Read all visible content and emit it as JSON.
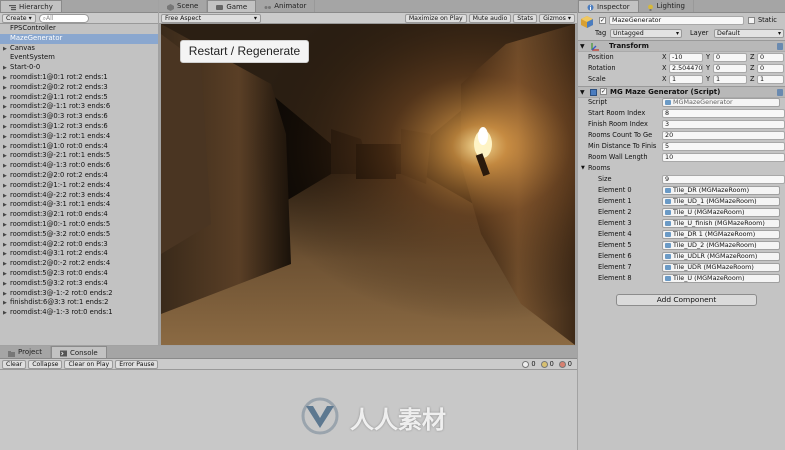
{
  "hierarchy": {
    "tab": "Hierarchy",
    "create": "Create",
    "search_placeholder": "All",
    "items": [
      {
        "label": "FPSController",
        "arrow": ""
      },
      {
        "label": "MazeGenerator",
        "arrow": "",
        "selected": true
      },
      {
        "label": "Canvas",
        "arrow": "▶"
      },
      {
        "label": "EventSystem",
        "arrow": ""
      },
      {
        "label": "Start-0-0",
        "arrow": "▶"
      },
      {
        "label": "roomdist:1@0:1 rot:2 ends:1",
        "arrow": "▶"
      },
      {
        "label": "roomdist:2@0:2 rot:2 ends:3",
        "arrow": "▶"
      },
      {
        "label": "roomdist:2@1:1 rot:2 ends:5",
        "arrow": "▶"
      },
      {
        "label": "roomdist:2@-1:1 rot:3 ends:6",
        "arrow": "▶"
      },
      {
        "label": "roomdist:3@0:3 rot:3 ends:6",
        "arrow": "▶"
      },
      {
        "label": "roomdist:3@1:2 rot:3 ends:6",
        "arrow": "▶"
      },
      {
        "label": "roomdist:3@-1:2 rot:1 ends:4",
        "arrow": "▶"
      },
      {
        "label": "roomdist:1@1:0 rot:0 ends:4",
        "arrow": "▶"
      },
      {
        "label": "roomdist:3@-2:1 rot:1 ends:5",
        "arrow": "▶"
      },
      {
        "label": "roomdist:4@-1:3 rot:0 ends:6",
        "arrow": "▶"
      },
      {
        "label": "roomdist:2@2:0 rot:2 ends:4",
        "arrow": "▶"
      },
      {
        "label": "roomdist:2@1:-1 rot:2 ends:4",
        "arrow": "▶"
      },
      {
        "label": "roomdist:4@-2:2 rot:3 ends:4",
        "arrow": "▶"
      },
      {
        "label": "roomdist:4@-3:1 rot:1 ends:4",
        "arrow": "▶"
      },
      {
        "label": "roomdist:3@2:1 rot:0 ends:4",
        "arrow": "▶"
      },
      {
        "label": "roomdist:1@0:-1 rot:0 ends:5",
        "arrow": "▶"
      },
      {
        "label": "roomdist:5@-3:2 rot:0 ends:5",
        "arrow": "▶"
      },
      {
        "label": "roomdist:4@2:2 rot:0 ends:3",
        "arrow": "▶"
      },
      {
        "label": "roomdist:4@3:1 rot:2 ends:4",
        "arrow": "▶"
      },
      {
        "label": "roomdist:2@0:-2 rot:2 ends:4",
        "arrow": "▶"
      },
      {
        "label": "roomdist:5@2:3 rot:0 ends:4",
        "arrow": "▶"
      },
      {
        "label": "roomdist:5@3:2 rot:3 ends:4",
        "arrow": "▶"
      },
      {
        "label": "roomdist:3@-1:-2 rot:0 ends:2",
        "arrow": "▶"
      },
      {
        "label": "finishdist:6@3:3 rot:1 ends:2",
        "arrow": "▶"
      },
      {
        "label": "roomdist:4@-1:-3 rot:0 ends:1",
        "arrow": "▶"
      }
    ]
  },
  "game": {
    "tabs": {
      "scene": "Scene",
      "game": "Game",
      "animator": "Animator"
    },
    "aspect": "Free Aspect",
    "maximize": "Maximize on Play",
    "mute": "Mute audio",
    "stats": "Stats",
    "gizmos": "Gizmos",
    "restart_button": "Restart / Regenerate"
  },
  "inspector": {
    "tabs": {
      "inspector": "Inspector",
      "lighting": "Lighting"
    },
    "object_name": "MazeGenerator",
    "static_label": "Static",
    "tag_label": "Tag",
    "tag_value": "Untagged",
    "layer_label": "Layer",
    "layer_value": "Default",
    "transform": {
      "title": "Transform",
      "position_label": "Position",
      "rotation_label": "Rotation",
      "scale_label": "Scale",
      "position": {
        "x": "-10",
        "y": "0",
        "z": "0"
      },
      "rotation": {
        "x": "2.504470",
        "y": "0",
        "z": "0"
      },
      "scale": {
        "x": "1",
        "y": "1",
        "z": "1"
      }
    },
    "script_comp": {
      "title": "MG Maze Generator (Script)",
      "script_label": "Script",
      "script_value": "MGMazeGenerator",
      "start_room_label": "Start Room Index",
      "start_room_value": "8",
      "finish_room_label": "Finish Room Index",
      "finish_room_value": "3",
      "rooms_count_label": "Rooms Count To Ge",
      "rooms_count_value": "20",
      "min_dist_label": "Min Distance To Finis",
      "min_dist_value": "5",
      "wall_len_label": "Room Wall Length",
      "wall_len_value": "10",
      "rooms_label": "Rooms",
      "size_label": "Size",
      "size_value": "9",
      "elements": [
        {
          "label": "Element 0",
          "value": "Tile_DR (MGMazeRoom)"
        },
        {
          "label": "Element 1",
          "value": "Tile_UD_1 (MGMazeRoom)"
        },
        {
          "label": "Element 2",
          "value": "Tile_U (MGMazeRoom)"
        },
        {
          "label": "Element 3",
          "value": "Tile_U_finish (MGMazeRoom)"
        },
        {
          "label": "Element 4",
          "value": "Tile_DR 1 (MGMazeRoom)"
        },
        {
          "label": "Element 5",
          "value": "Tile_UD_2 (MGMazeRoom)"
        },
        {
          "label": "Element 6",
          "value": "Tile_UDLR (MGMazeRoom)"
        },
        {
          "label": "Element 7",
          "value": "Tile_UDR (MGMazeRoom)"
        },
        {
          "label": "Element 8",
          "value": "Tile_U (MGMazeRoom)"
        }
      ]
    },
    "add_component": "Add Component"
  },
  "console": {
    "tabs": {
      "project": "Project",
      "console": "Console"
    },
    "clear": "Clear",
    "collapse": "Collapse",
    "clear_on_play": "Clear on Play",
    "error_pause": "Error Pause",
    "count_log": "0",
    "count_warn": "0",
    "count_error": "0"
  },
  "watermark": "人人素材"
}
